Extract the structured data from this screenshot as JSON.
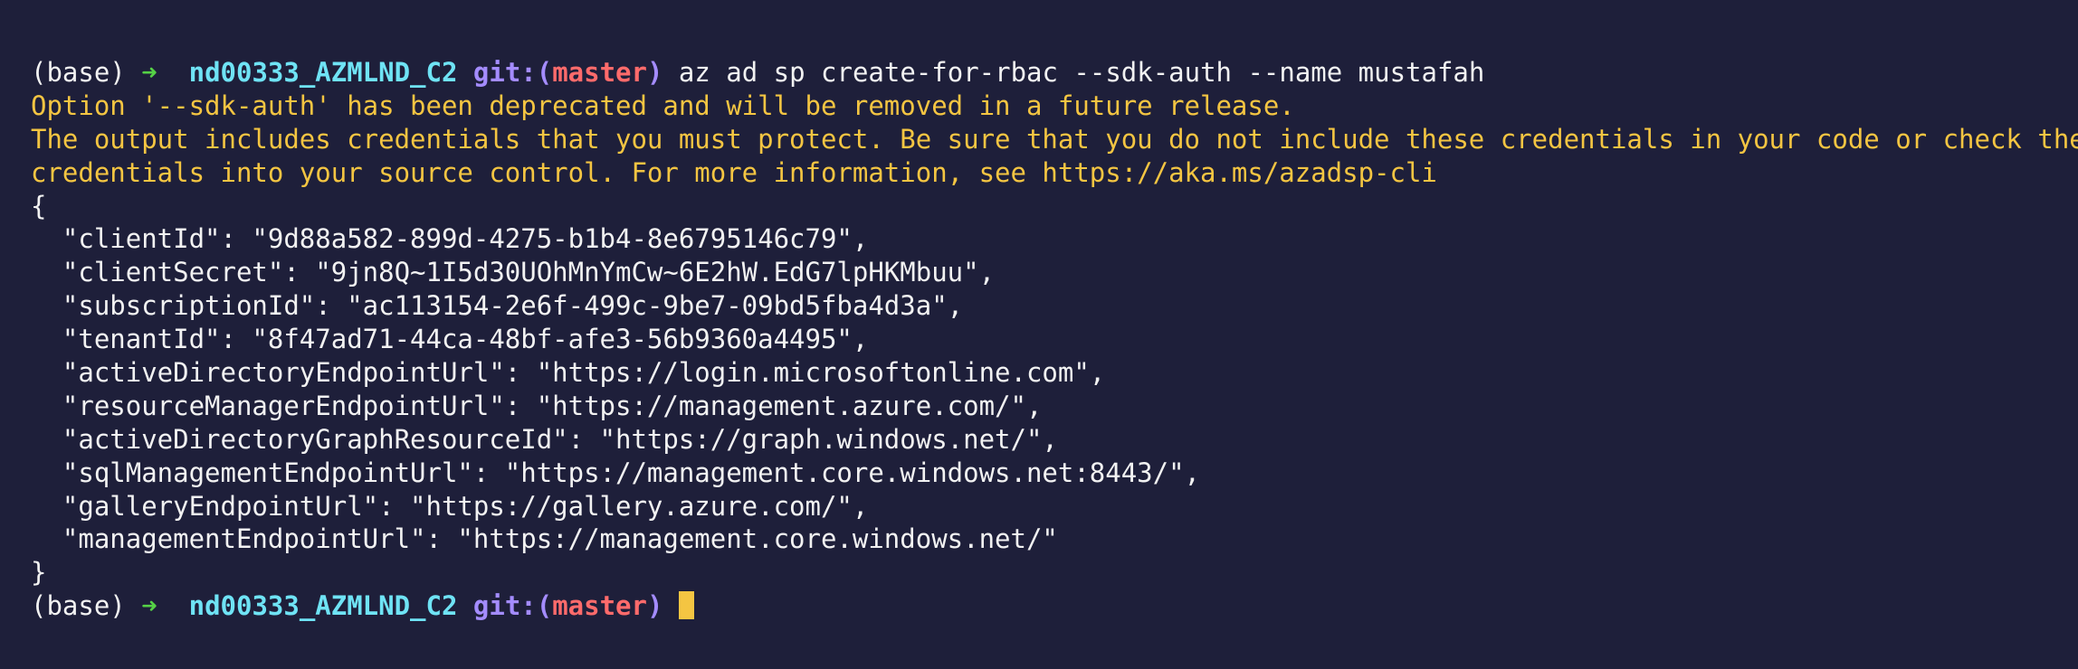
{
  "prompt": {
    "env": "(base)",
    "arrow": "➜",
    "directory": "nd00333_AZMLND_C2",
    "git_prefix": "git:(",
    "branch": "master",
    "git_suffix": ")"
  },
  "command": "az ad sp create-for-rbac --sdk-auth --name mustafah",
  "warnings": [
    "Option '--sdk-auth' has been deprecated and will be removed in a future release.",
    "The output includes credentials that you must protect. Be sure that you do not include these credentials in your code or check the",
    "credentials into your source control. For more information, see https://aka.ms/azadsp-cli"
  ],
  "json_open": "{",
  "json_lines": [
    "  \"clientId\": \"9d88a582-899d-4275-b1b4-8e6795146c79\",",
    "  \"clientSecret\": \"9jn8Q~1I5d30UOhMnYmCw~6E2hW.EdG7lpHKMbuu\",",
    "  \"subscriptionId\": \"ac113154-2e6f-499c-9be7-09bd5fba4d3a\",",
    "  \"tenantId\": \"8f47ad71-44ca-48bf-afe3-56b9360a4495\",",
    "  \"activeDirectoryEndpointUrl\": \"https://login.microsoftonline.com\",",
    "  \"resourceManagerEndpointUrl\": \"https://management.azure.com/\",",
    "  \"activeDirectoryGraphResourceId\": \"https://graph.windows.net/\",",
    "  \"sqlManagementEndpointUrl\": \"https://management.core.windows.net:8443/\",",
    "  \"galleryEndpointUrl\": \"https://gallery.azure.com/\",",
    "  \"managementEndpointUrl\": \"https://management.core.windows.net/\""
  ],
  "json_close": "}",
  "colors": {
    "background": "#1e1f3a",
    "text": "#f2f2f2",
    "warning": "#f4c542",
    "arrow": "#55d146",
    "directory": "#6fe3f5",
    "git": "#a48cff",
    "branch": "#ff6b6b",
    "cursor": "#f4c542"
  }
}
